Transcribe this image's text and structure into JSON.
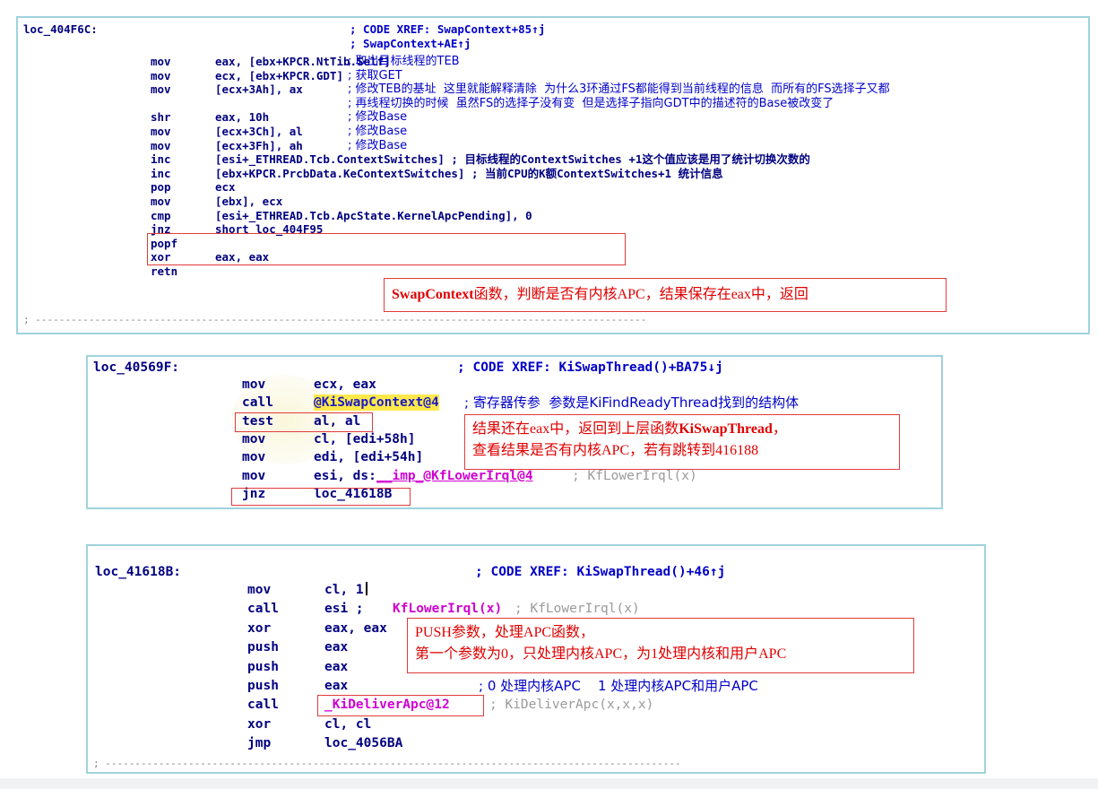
{
  "panel1": {
    "label": "loc_404F6C:",
    "xref1": "; CODE XREF: SwapContext+85↑j",
    "xref2": "; SwapContext+AE↑j",
    "rows": [
      {
        "mn": "mov",
        "op": "eax, [ebx+KPCR.NtTib.Self]",
        "cm": "; 取出目标线程的TEB"
      },
      {
        "mn": "mov",
        "op": "ecx, [ebx+KPCR.GDT]",
        "cm": "; 获取GET"
      },
      {
        "mn": "mov",
        "op": "[ecx+3Ah], ax",
        "cm": "; 修改TEB的基址  这里就能解释清除  为什么3环通过FS都能得到当前线程的信息  而所有的FS选择子又都"
      },
      {
        "mn": "",
        "op": "",
        "cm": "; 再线程切换的时候  虽然FS的选择子没有变  但是选择子指向GDT中的描述符的Base被改变了"
      },
      {
        "mn": "shr",
        "op": "eax, 10h",
        "cm": "; 修改Base"
      },
      {
        "mn": "mov",
        "op": "[ecx+3Ch], al",
        "cm": "; 修改Base"
      },
      {
        "mn": "mov",
        "op": "[ecx+3Fh], ah",
        "cm": "; 修改Base"
      },
      {
        "mn": "inc",
        "op": "[esi+_ETHREAD.Tcb.ContextSwitches] ; 目标线程的ContextSwitches +1这个值应该是用了统计切换次数的",
        "cm": ""
      },
      {
        "mn": "inc",
        "op": "[ebx+KPCR.PrcbData.KeContextSwitches] ; 当前CPU的K额ContextSwitches+1 统计信息",
        "cm": ""
      },
      {
        "mn": "pop",
        "op": "ecx",
        "cm": ""
      },
      {
        "mn": "mov",
        "op": "[ebx], ecx",
        "cm": ""
      },
      {
        "mn": "cmp",
        "op": "[esi+_ETHREAD.Tcb.ApcState.KernelApcPending], 0",
        "cm": ""
      },
      {
        "mn": "jnz",
        "op": "short loc_404F95",
        "cm": ""
      },
      {
        "mn": "popf",
        "op": "",
        "cm": ""
      },
      {
        "mn": "xor",
        "op": "eax, eax",
        "cm": ""
      },
      {
        "mn": "retn",
        "op": "",
        "cm": ""
      }
    ],
    "separator": "; -------------------------------------------------------------------------------------------------------",
    "note_bold": "SwapContext",
    "note_rest": "函数，判断是否有内核APC，结果保存在eax中，返回"
  },
  "panel2": {
    "label": "loc_40569F:",
    "xref": "; CODE XREF: KiSwapThread()+BA75↓j",
    "rows": [
      {
        "mn": "mov",
        "op": "ecx, eax"
      },
      {
        "mn": "call",
        "op": "@KiSwapContext@4",
        "cm": "; 寄存器传参  参数是KiFindReadyThread找到的结构体"
      },
      {
        "mn": "test",
        "op": "al, al"
      },
      {
        "mn": "mov",
        "op": "cl, [edi+58h]"
      },
      {
        "mn": "mov",
        "op": "edi, [edi+54h]"
      },
      {
        "mn": "mov",
        "op": "esi, ds:",
        "op2": "__imp_@KfLowerIrql@4",
        "cm": "; KfLowerIrql(x)"
      },
      {
        "mn": "jnz",
        "op": "loc_41618B"
      }
    ],
    "note_line1_a": "结果还在eax中，返回到上层函数",
    "note_line1_b": "KiSwapThread",
    "note_line1_c": "，",
    "note_line2": "查看结果是否有内核APC，若有跳转到416188"
  },
  "panel3": {
    "label": "loc_41618B:",
    "xref": "; CODE XREF: KiSwapThread()+46↑j",
    "rows": [
      {
        "mn": "mov",
        "op": "cl, 1"
      },
      {
        "mn": "call",
        "op": "esi ;",
        "op2": "KfLowerIrql(x)",
        "cm": "; KfLowerIrql(x)"
      },
      {
        "mn": "xor",
        "op": "eax, eax"
      },
      {
        "mn": "push",
        "op": "eax"
      },
      {
        "mn": "push",
        "op": "eax"
      },
      {
        "mn": "push",
        "op": "eax",
        "cm": "; 0 处理内核APC    1 处理内核APC和用户APC"
      },
      {
        "mn": "call",
        "op": "_KiDeliverApc@12",
        "cm": "; KiDeliverApc(x,x,x)"
      },
      {
        "mn": "xor",
        "op": "cl, cl"
      },
      {
        "mn": "jmp",
        "op": "loc_4056BA"
      }
    ],
    "separator": "; -------------------------------------------------------------------------------------------------",
    "note_line1": "PUSH参数，处理APC函数，",
    "note_line2": "第一个参数为0，只处理内核APC，为1处理内核和用户APC"
  }
}
